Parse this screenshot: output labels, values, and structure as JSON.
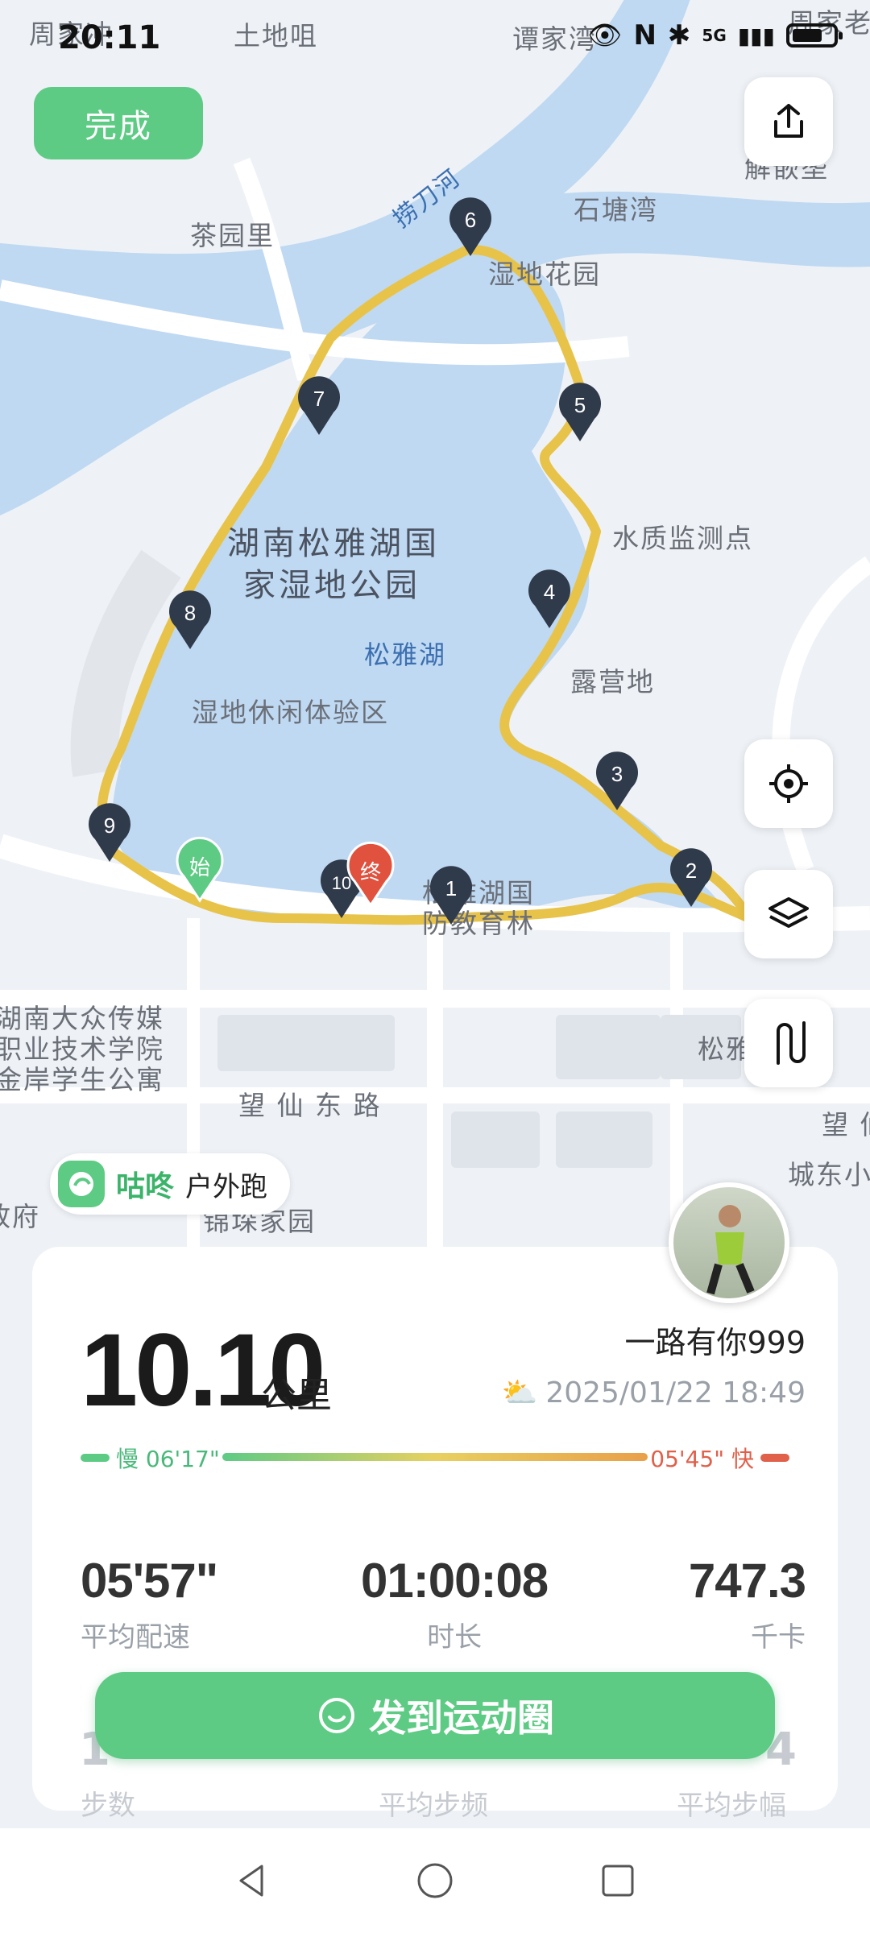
{
  "status_bar": {
    "time": "20:11",
    "network": "5G"
  },
  "map": {
    "labels": {
      "zhoujiachong": "周家冲",
      "tudiju": "土地咀",
      "tanjiawan": "谭家湾",
      "zhoujiayuan": "周家老",
      "chayuanli": "茶园里",
      "laodaohe": "捞刀河",
      "shitangwan": "石塘湾",
      "paoba": "解嵌垄",
      "shidi_huayuan": "湿地花园",
      "shuizhi": "水质监测点",
      "park1": "湖南松雅湖国",
      "park2": "家湿地公园",
      "songyahu": "松雅湖",
      "luyingdi": "露营地",
      "xiuxian": "湿地休闲体验区",
      "guofang": "松雅湖国",
      "guofang2": "防教育林",
      "hunan_media1": "湖南大众传媒",
      "hunan_media2": "职业技术学院",
      "apartment": "金岸学生公寓",
      "wangxian": "望 仙 东 路",
      "songya": "松雅",
      "wang": "望 仙",
      "chengdong": "城东小",
      "zhengfu": "政府",
      "jinhe": "锦垛家园"
    },
    "start_marker": "始",
    "end_marker": "终",
    "km_markers": [
      "1",
      "2",
      "3",
      "4",
      "5",
      "6",
      "7",
      "8",
      "9",
      "10"
    ]
  },
  "done_button": "完成",
  "brand": {
    "name": "咕咚",
    "activity": "户外跑"
  },
  "summary": {
    "distance": "10.10",
    "distance_unit": "公里",
    "nickname": "一路有你999",
    "datetime": "2025/01/22 18:49",
    "pace_slow_label": "慢 06'17\"",
    "pace_fast_label": "05'45\" 快"
  },
  "stats": [
    {
      "value": "05'57\"",
      "label": "平均配速"
    },
    {
      "value": "01:00:08",
      "label": "时长"
    },
    {
      "value": "747.3",
      "label": "千卡"
    }
  ],
  "faded_stats": {
    "steps": "步数",
    "cadence": "平均步频",
    "stride": "平均步幅",
    "steps_digit": "1",
    "stride_digit": "4"
  },
  "share_button": "发到运动圈"
}
